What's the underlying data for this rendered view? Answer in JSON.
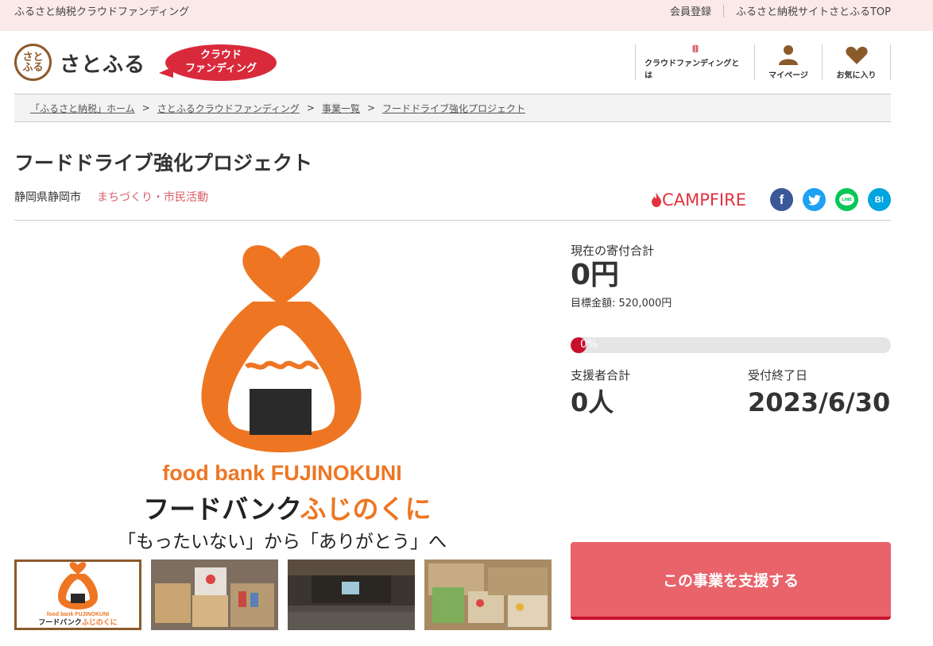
{
  "topbar": {
    "site_name": "ふるさと納税クラウドファンディング",
    "links": [
      "会員登録",
      "ふるさと納税サイトさとふるTOP"
    ]
  },
  "header": {
    "logo_mark": "さと\nふる",
    "logo_text": "さとふる",
    "badge_line1": "クラウド",
    "badge_line2": "ファンディング",
    "nav": [
      {
        "label": "クラウドファンディングとは",
        "icon": "book-icon"
      },
      {
        "label": "マイページ",
        "icon": "user-icon"
      },
      {
        "label": "お気に入り",
        "icon": "heart-icon"
      }
    ]
  },
  "breadcrumb": [
    "「ふるさと納税」ホーム",
    "さとふるクラウドファンディング",
    "事業一覧",
    "フードドライブ強化プロジェクト"
  ],
  "project": {
    "title": "フードドライブ強化プロジェクト",
    "location": "静岡県静岡市",
    "category": "まちづくり・市民活動",
    "partner": "CAMPFIRE"
  },
  "share": [
    {
      "name": "facebook",
      "glyph": "f",
      "color": "#3b5998"
    },
    {
      "name": "twitter",
      "glyph": "t",
      "color": "#1da1f2"
    },
    {
      "name": "line",
      "glyph": "LINE",
      "color": "#06c755"
    },
    {
      "name": "hatena",
      "glyph": "B!",
      "color": "#00a4de"
    }
  ],
  "image": {
    "brand_en": "food bank FUJINOKUNI",
    "brand_jp_a": "フードバンク",
    "brand_jp_b": "ふじのくに",
    "tagline": "「もったいない」から「ありがとう」へ"
  },
  "stats": {
    "total_label": "現在の寄付合計",
    "total_value": "0円",
    "goal": "目標金額: 520,000円",
    "progress_text": "0%",
    "progress_fraction": 0.0,
    "supporters_label": "支援者合計",
    "supporters_value": "0人",
    "deadline_label": "受付終了日",
    "deadline_value": "2023/6/30"
  },
  "cta": {
    "label": "この事業を支援する"
  },
  "colors": {
    "accent": "#e8636a",
    "brand_red": "#c8102e",
    "orange": "#ee7623",
    "topbar": "#fbe9ea"
  }
}
